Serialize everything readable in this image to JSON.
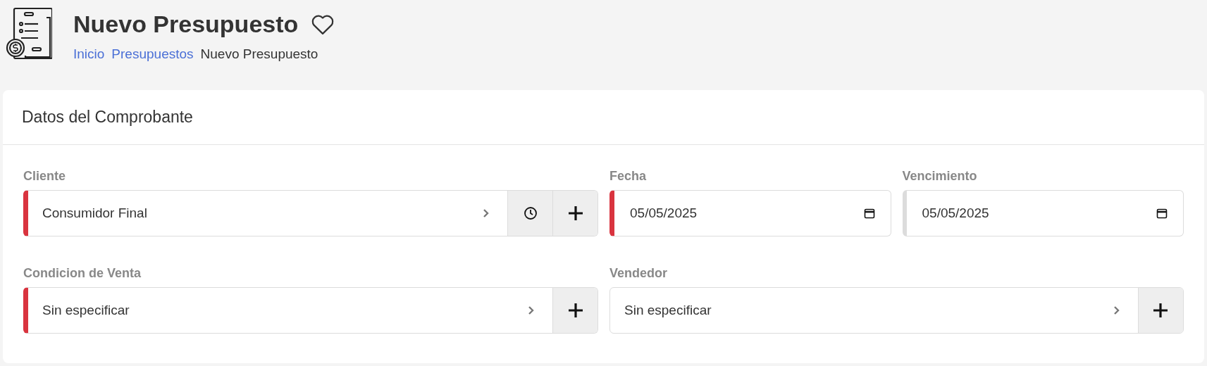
{
  "page": {
    "title": "Nuevo Presupuesto",
    "favorite": false
  },
  "breadcrumb": [
    {
      "label": "Inicio",
      "link": true
    },
    {
      "label": "Presupuestos",
      "link": true
    },
    {
      "label": "Nuevo Presupuesto",
      "link": false
    }
  ],
  "card": {
    "title": "Datos del Comprobante",
    "rows": [
      [
        {
          "label": "Cliente",
          "kind": "select",
          "value": "Consumidor Final",
          "required": true,
          "buttons": [
            {
              "kind": "history"
            },
            {
              "kind": "add"
            }
          ]
        },
        {
          "label": "Fecha",
          "kind": "date",
          "value": "05/05/2025",
          "required": true
        },
        {
          "label": "Vencimiento",
          "kind": "date",
          "value": "05/05/2025",
          "required": false
        }
      ],
      [
        {
          "label": "Condicion de Venta",
          "kind": "select",
          "value": "Sin especificar",
          "required": true,
          "buttons": [
            {
              "kind": "add"
            }
          ]
        },
        {
          "label": "Vendedor",
          "kind": "select",
          "value": "Sin especificar",
          "required": false,
          "buttons": [
            {
              "kind": "add"
            }
          ]
        }
      ]
    ]
  }
}
